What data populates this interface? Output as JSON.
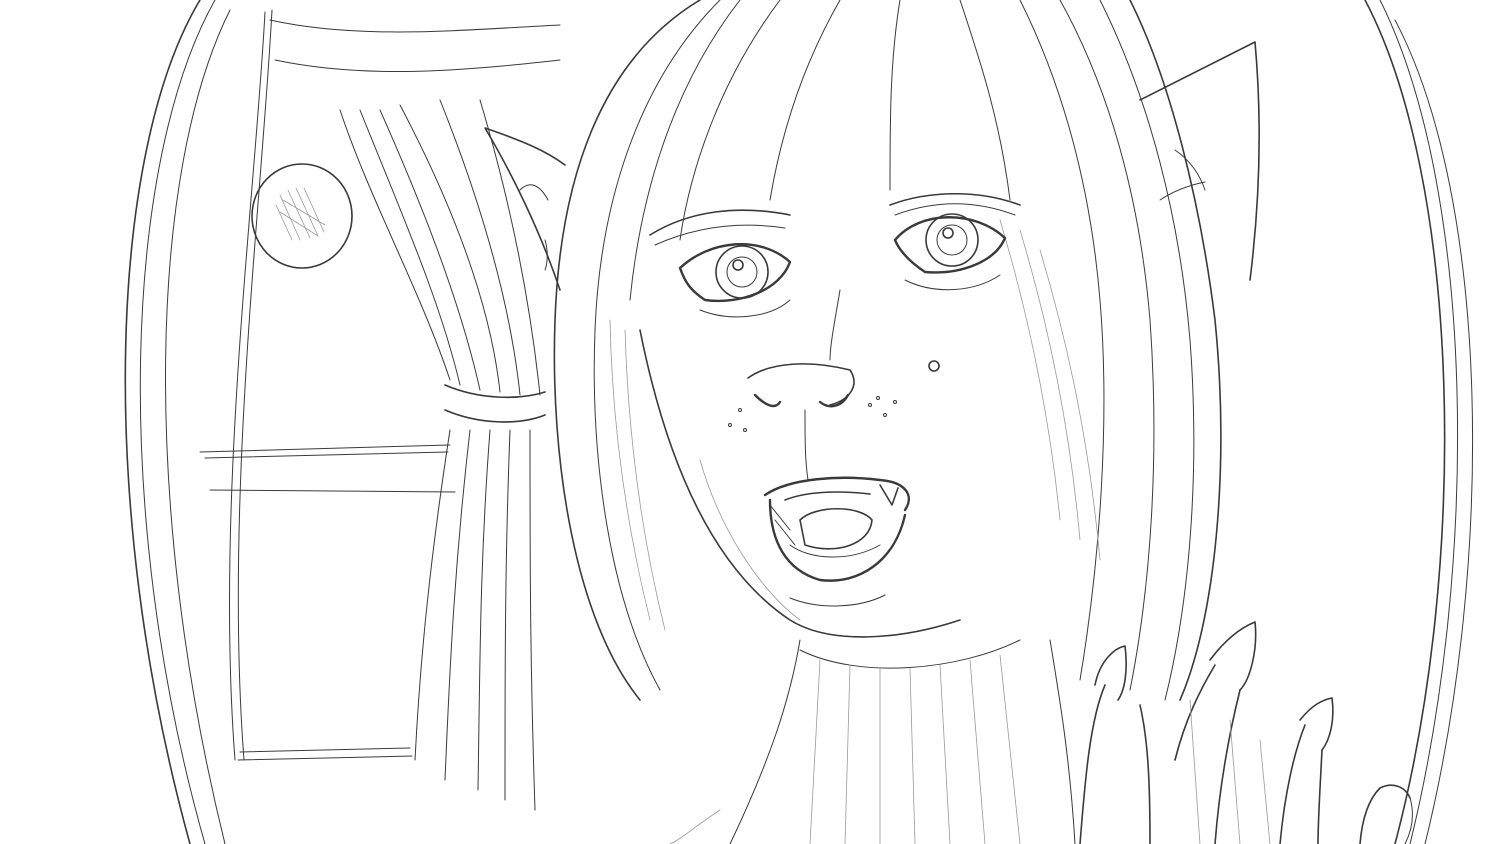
{
  "artwork": {
    "kind": "pencil-sketch",
    "subject": "werewolf-woman-portrait",
    "colors": {
      "background": "#ffffff",
      "line": "#3a3a3a",
      "hatch": "#9a9a9a"
    }
  }
}
